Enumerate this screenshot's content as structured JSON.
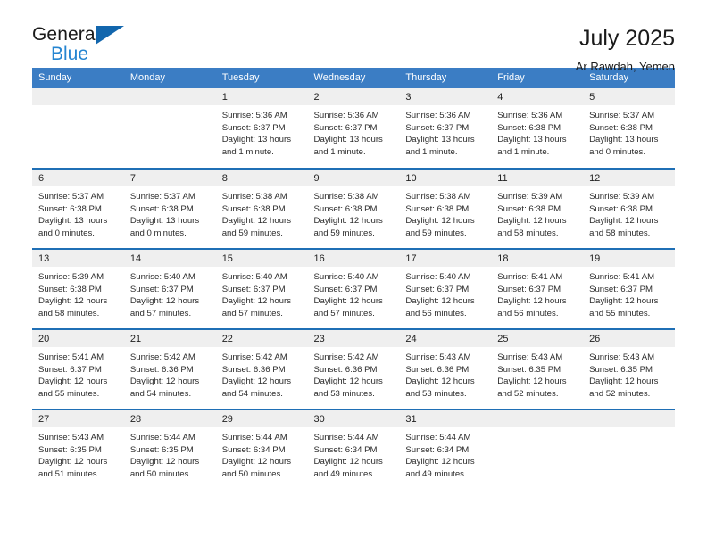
{
  "brand": {
    "name_top": "General",
    "name_bottom": "Blue",
    "accent_color": "#2585d1",
    "triangle_color": "#1266ad"
  },
  "header": {
    "title": "July 2025",
    "subtitle": "Ar Rawdah, Yemen"
  },
  "calendar": {
    "header_bg": "#3b7dc4",
    "row_divider_color": "#1f6fb5",
    "daynum_strip_bg": "#efefef",
    "weekdays": [
      "Sunday",
      "Monday",
      "Tuesday",
      "Wednesday",
      "Thursday",
      "Friday",
      "Saturday"
    ],
    "weeks": [
      [
        {
          "day": "",
          "empty": true
        },
        {
          "day": "",
          "empty": true
        },
        {
          "day": "1",
          "sunrise": "Sunrise: 5:36 AM",
          "sunset": "Sunset: 6:37 PM",
          "daylight": "Daylight: 13 hours and 1 minute."
        },
        {
          "day": "2",
          "sunrise": "Sunrise: 5:36 AM",
          "sunset": "Sunset: 6:37 PM",
          "daylight": "Daylight: 13 hours and 1 minute."
        },
        {
          "day": "3",
          "sunrise": "Sunrise: 5:36 AM",
          "sunset": "Sunset: 6:37 PM",
          "daylight": "Daylight: 13 hours and 1 minute."
        },
        {
          "day": "4",
          "sunrise": "Sunrise: 5:36 AM",
          "sunset": "Sunset: 6:38 PM",
          "daylight": "Daylight: 13 hours and 1 minute."
        },
        {
          "day": "5",
          "sunrise": "Sunrise: 5:37 AM",
          "sunset": "Sunset: 6:38 PM",
          "daylight": "Daylight: 13 hours and 0 minutes."
        }
      ],
      [
        {
          "day": "6",
          "sunrise": "Sunrise: 5:37 AM",
          "sunset": "Sunset: 6:38 PM",
          "daylight": "Daylight: 13 hours and 0 minutes."
        },
        {
          "day": "7",
          "sunrise": "Sunrise: 5:37 AM",
          "sunset": "Sunset: 6:38 PM",
          "daylight": "Daylight: 13 hours and 0 minutes."
        },
        {
          "day": "8",
          "sunrise": "Sunrise: 5:38 AM",
          "sunset": "Sunset: 6:38 PM",
          "daylight": "Daylight: 12 hours and 59 minutes."
        },
        {
          "day": "9",
          "sunrise": "Sunrise: 5:38 AM",
          "sunset": "Sunset: 6:38 PM",
          "daylight": "Daylight: 12 hours and 59 minutes."
        },
        {
          "day": "10",
          "sunrise": "Sunrise: 5:38 AM",
          "sunset": "Sunset: 6:38 PM",
          "daylight": "Daylight: 12 hours and 59 minutes."
        },
        {
          "day": "11",
          "sunrise": "Sunrise: 5:39 AM",
          "sunset": "Sunset: 6:38 PM",
          "daylight": "Daylight: 12 hours and 58 minutes."
        },
        {
          "day": "12",
          "sunrise": "Sunrise: 5:39 AM",
          "sunset": "Sunset: 6:38 PM",
          "daylight": "Daylight: 12 hours and 58 minutes."
        }
      ],
      [
        {
          "day": "13",
          "sunrise": "Sunrise: 5:39 AM",
          "sunset": "Sunset: 6:38 PM",
          "daylight": "Daylight: 12 hours and 58 minutes."
        },
        {
          "day": "14",
          "sunrise": "Sunrise: 5:40 AM",
          "sunset": "Sunset: 6:37 PM",
          "daylight": "Daylight: 12 hours and 57 minutes."
        },
        {
          "day": "15",
          "sunrise": "Sunrise: 5:40 AM",
          "sunset": "Sunset: 6:37 PM",
          "daylight": "Daylight: 12 hours and 57 minutes."
        },
        {
          "day": "16",
          "sunrise": "Sunrise: 5:40 AM",
          "sunset": "Sunset: 6:37 PM",
          "daylight": "Daylight: 12 hours and 57 minutes."
        },
        {
          "day": "17",
          "sunrise": "Sunrise: 5:40 AM",
          "sunset": "Sunset: 6:37 PM",
          "daylight": "Daylight: 12 hours and 56 minutes."
        },
        {
          "day": "18",
          "sunrise": "Sunrise: 5:41 AM",
          "sunset": "Sunset: 6:37 PM",
          "daylight": "Daylight: 12 hours and 56 minutes."
        },
        {
          "day": "19",
          "sunrise": "Sunrise: 5:41 AM",
          "sunset": "Sunset: 6:37 PM",
          "daylight": "Daylight: 12 hours and 55 minutes."
        }
      ],
      [
        {
          "day": "20",
          "sunrise": "Sunrise: 5:41 AM",
          "sunset": "Sunset: 6:37 PM",
          "daylight": "Daylight: 12 hours and 55 minutes."
        },
        {
          "day": "21",
          "sunrise": "Sunrise: 5:42 AM",
          "sunset": "Sunset: 6:36 PM",
          "daylight": "Daylight: 12 hours and 54 minutes."
        },
        {
          "day": "22",
          "sunrise": "Sunrise: 5:42 AM",
          "sunset": "Sunset: 6:36 PM",
          "daylight": "Daylight: 12 hours and 54 minutes."
        },
        {
          "day": "23",
          "sunrise": "Sunrise: 5:42 AM",
          "sunset": "Sunset: 6:36 PM",
          "daylight": "Daylight: 12 hours and 53 minutes."
        },
        {
          "day": "24",
          "sunrise": "Sunrise: 5:43 AM",
          "sunset": "Sunset: 6:36 PM",
          "daylight": "Daylight: 12 hours and 53 minutes."
        },
        {
          "day": "25",
          "sunrise": "Sunrise: 5:43 AM",
          "sunset": "Sunset: 6:35 PM",
          "daylight": "Daylight: 12 hours and 52 minutes."
        },
        {
          "day": "26",
          "sunrise": "Sunrise: 5:43 AM",
          "sunset": "Sunset: 6:35 PM",
          "daylight": "Daylight: 12 hours and 52 minutes."
        }
      ],
      [
        {
          "day": "27",
          "sunrise": "Sunrise: 5:43 AM",
          "sunset": "Sunset: 6:35 PM",
          "daylight": "Daylight: 12 hours and 51 minutes."
        },
        {
          "day": "28",
          "sunrise": "Sunrise: 5:44 AM",
          "sunset": "Sunset: 6:35 PM",
          "daylight": "Daylight: 12 hours and 50 minutes."
        },
        {
          "day": "29",
          "sunrise": "Sunrise: 5:44 AM",
          "sunset": "Sunset: 6:34 PM",
          "daylight": "Daylight: 12 hours and 50 minutes."
        },
        {
          "day": "30",
          "sunrise": "Sunrise: 5:44 AM",
          "sunset": "Sunset: 6:34 PM",
          "daylight": "Daylight: 12 hours and 49 minutes."
        },
        {
          "day": "31",
          "sunrise": "Sunrise: 5:44 AM",
          "sunset": "Sunset: 6:34 PM",
          "daylight": "Daylight: 12 hours and 49 minutes."
        },
        {
          "day": "",
          "empty": true
        },
        {
          "day": "",
          "empty": true
        }
      ]
    ]
  }
}
